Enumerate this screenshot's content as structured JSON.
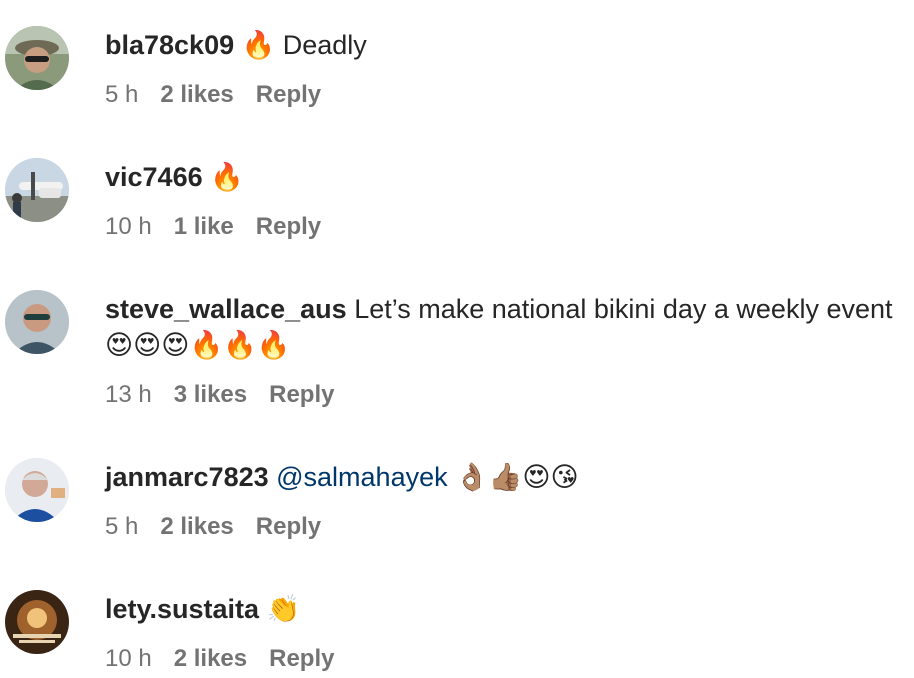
{
  "comments": [
    {
      "username": "bla78ck09",
      "text": " 🔥 Deadly",
      "mention": "",
      "time": "5 h",
      "likes": "2 likes",
      "reply": "Reply",
      "avatar_icon": "avatar-man-sunglasses-hat"
    },
    {
      "username": "vic7466",
      "text": " 🔥",
      "mention": "",
      "time": "10 h",
      "likes": "1 like",
      "reply": "Reply",
      "avatar_icon": "avatar-man-with-airplane"
    },
    {
      "username": "steve_wallace_aus",
      "text": " Let’s make national bikini day a weekly event 😍😍😍🔥🔥🔥",
      "mention": "",
      "time": "13 h",
      "likes": "3 likes",
      "reply": "Reply",
      "avatar_icon": "avatar-man-sunglasses"
    },
    {
      "username": "janmarc7823",
      "text": " 👌🏽👍🏽😍😘",
      "mention": " @salmahayek",
      "time": "5 h",
      "likes": "2 likes",
      "reply": "Reply",
      "avatar_icon": "avatar-older-man"
    },
    {
      "username": "lety.sustaita",
      "text": " 👏",
      "mention": "",
      "time": "10 h",
      "likes": "2 likes",
      "reply": "Reply",
      "avatar_icon": "avatar-candlelight-image"
    }
  ],
  "colors": {
    "text": "#262626",
    "meta": "#737373",
    "mention": "#00376b"
  }
}
